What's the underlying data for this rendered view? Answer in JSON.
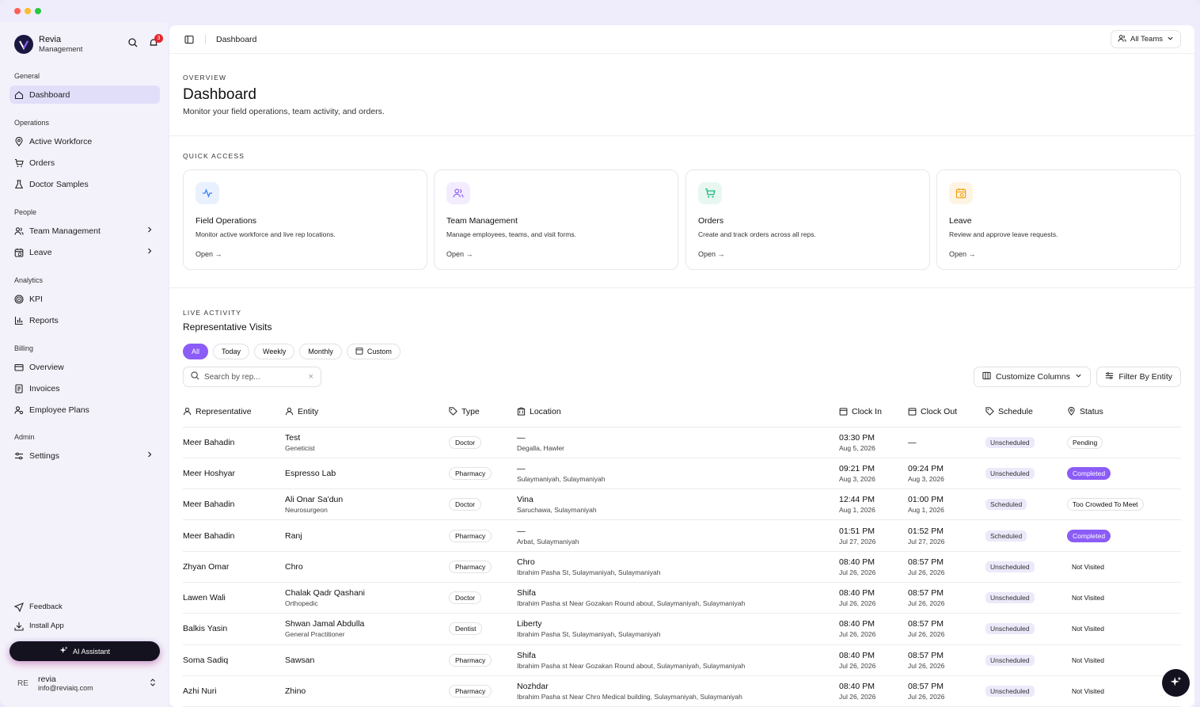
{
  "brand": {
    "name": "Revia",
    "sub": "Management"
  },
  "notifications": {
    "count": "3"
  },
  "sidebar": {
    "sections": [
      "General",
      "Operations",
      "People",
      "Analytics",
      "Billing",
      "Admin"
    ],
    "items": [
      {
        "label": "Dashboard",
        "icon": "home-icon"
      },
      {
        "label": "Active Workforce",
        "icon": "map-pin-icon"
      },
      {
        "label": "Orders",
        "icon": "cart-icon"
      },
      {
        "label": "Doctor Samples",
        "icon": "flask-icon"
      },
      {
        "label": "Team Management",
        "icon": "users-icon"
      },
      {
        "label": "Leave",
        "icon": "calendar-clock-icon"
      },
      {
        "label": "KPI",
        "icon": "target-icon"
      },
      {
        "label": "Reports",
        "icon": "bar-chart-icon"
      },
      {
        "label": "Overview",
        "icon": "card-icon"
      },
      {
        "label": "Invoices",
        "icon": "receipt-icon"
      },
      {
        "label": "Employee Plans",
        "icon": "user-cog-icon"
      },
      {
        "label": "Settings",
        "icon": "sliders-icon"
      }
    ],
    "footer": {
      "feedback": "Feedback",
      "install": "Install App",
      "ai": "AI Assistant"
    },
    "user": {
      "initials": "RE",
      "name": "revia",
      "email": "info@reviaiq.com"
    }
  },
  "topbar": {
    "title": "Dashboard",
    "teams": "All Teams"
  },
  "overview": {
    "kicker": "OVERVIEW",
    "title": "Dashboard",
    "desc": "Monitor your field operations, team activity, and orders."
  },
  "quick_access": {
    "kicker": "QUICK ACCESS",
    "cards": [
      {
        "title": "Field Operations",
        "desc": "Monitor active workforce and live rep locations.",
        "open": "Open →",
        "color": "#3b82f6"
      },
      {
        "title": "Team Management",
        "desc": "Manage employees, teams, and visit forms.",
        "open": "Open →",
        "color": "#8b5cf6"
      },
      {
        "title": "Orders",
        "desc": "Create and track orders across all reps.",
        "open": "Open →",
        "color": "#10b981"
      },
      {
        "title": "Leave",
        "desc": "Review and approve leave requests.",
        "open": "Open →",
        "color": "#f59e0b"
      }
    ]
  },
  "activity": {
    "kicker": "LIVE ACTIVITY",
    "title": "Representative Visits",
    "pills": [
      "All",
      "Today",
      "Weekly",
      "Monthly",
      "Custom"
    ],
    "search_placeholder": "Search by rep...",
    "customize": "Customize Columns",
    "filter": "Filter By Entity",
    "columns": [
      "Representative",
      "Entity",
      "Type",
      "Location",
      "Clock In",
      "Clock Out",
      "Schedule",
      "Status"
    ],
    "rows": [
      {
        "rep": "Meer Bahadin",
        "entity": "Test",
        "entity_sub": "Geneticist",
        "type": "Doctor",
        "loc": "—",
        "loc_sub": "Degalla, Hawler",
        "in": "03:30 PM",
        "in_date": "Aug 5, 2026",
        "out": "—",
        "out_date": "",
        "schedule": "Unscheduled",
        "status": "Pending"
      },
      {
        "rep": "Meer Hoshyar",
        "entity": "Espresso Lab",
        "entity_sub": "",
        "type": "Pharmacy",
        "loc": "—",
        "loc_sub": "Sulaymaniyah, Sulaymaniyah",
        "in": "09:21 PM",
        "in_date": "Aug 3, 2026",
        "out": "09:24 PM",
        "out_date": "Aug 3, 2026",
        "schedule": "Unscheduled",
        "status": "Completed"
      },
      {
        "rep": "Meer Bahadin",
        "entity": "Ali Onar Sa'dun",
        "entity_sub": "Neurosurgeon",
        "type": "Doctor",
        "loc": "Vina",
        "loc_sub": "Saruchawa, Sulaymaniyah",
        "in": "12:44 PM",
        "in_date": "Aug 1, 2026",
        "out": "01:00 PM",
        "out_date": "Aug 1, 2026",
        "schedule": "Scheduled",
        "status": "Too Crowded To Meet"
      },
      {
        "rep": "Meer Bahadin",
        "entity": "Ranj",
        "entity_sub": "",
        "type": "Pharmacy",
        "loc": "—",
        "loc_sub": "Arbat, Sulaymaniyah",
        "in": "01:51 PM",
        "in_date": "Jul 27, 2026",
        "out": "01:52 PM",
        "out_date": "Jul 27, 2026",
        "schedule": "Scheduled",
        "status": "Completed"
      },
      {
        "rep": "Zhyan Omar",
        "entity": "Chro",
        "entity_sub": "",
        "type": "Pharmacy",
        "loc": "Chro",
        "loc_sub": "Ibrahim Pasha St, Sulaymaniyah, Sulaymaniyah",
        "in": "08:40 PM",
        "in_date": "Jul 26, 2026",
        "out": "08:57 PM",
        "out_date": "Jul 26, 2026",
        "schedule": "Unscheduled",
        "status": "Not Visited"
      },
      {
        "rep": "Lawen Wali",
        "entity": "Chalak Qadr Qashani",
        "entity_sub": "Orthopedic",
        "type": "Doctor",
        "loc": "Shifa",
        "loc_sub": "Ibrahim Pasha st Near Gozakan Round about, Sulaymaniyah, Sulaymaniyah",
        "in": "08:40 PM",
        "in_date": "Jul 26, 2026",
        "out": "08:57 PM",
        "out_date": "Jul 26, 2026",
        "schedule": "Unscheduled",
        "status": "Not Visited"
      },
      {
        "rep": "Balkis Yasin",
        "entity": "Shwan Jamal Abdulla",
        "entity_sub": "General Practitioner",
        "type": "Dentist",
        "loc": "Liberty",
        "loc_sub": "Ibrahim Pasha St, Sulaymaniyah, Sulaymaniyah",
        "in": "08:40 PM",
        "in_date": "Jul 26, 2026",
        "out": "08:57 PM",
        "out_date": "Jul 26, 2026",
        "schedule": "Unscheduled",
        "status": "Not Visited"
      },
      {
        "rep": "Soma Sadiq",
        "entity": "Sawsan",
        "entity_sub": "",
        "type": "Pharmacy",
        "loc": "Shifa",
        "loc_sub": "Ibrahim Pasha st Near Gozakan Round about, Sulaymaniyah, Sulaymaniyah",
        "in": "08:40 PM",
        "in_date": "Jul 26, 2026",
        "out": "08:57 PM",
        "out_date": "Jul 26, 2026",
        "schedule": "Unscheduled",
        "status": "Not Visited"
      },
      {
        "rep": "Azhi Nuri",
        "entity": "Zhino",
        "entity_sub": "",
        "type": "Pharmacy",
        "loc": "Nozhdar",
        "loc_sub": "Ibrahim Pasha st Near Chro Medical building, Sulaymaniyah, Sulaymaniyah",
        "in": "08:40 PM",
        "in_date": "Jul 26, 2026",
        "out": "08:57 PM",
        "out_date": "Jul 26, 2026",
        "schedule": "Unscheduled",
        "status": "Not Visited"
      }
    ]
  }
}
